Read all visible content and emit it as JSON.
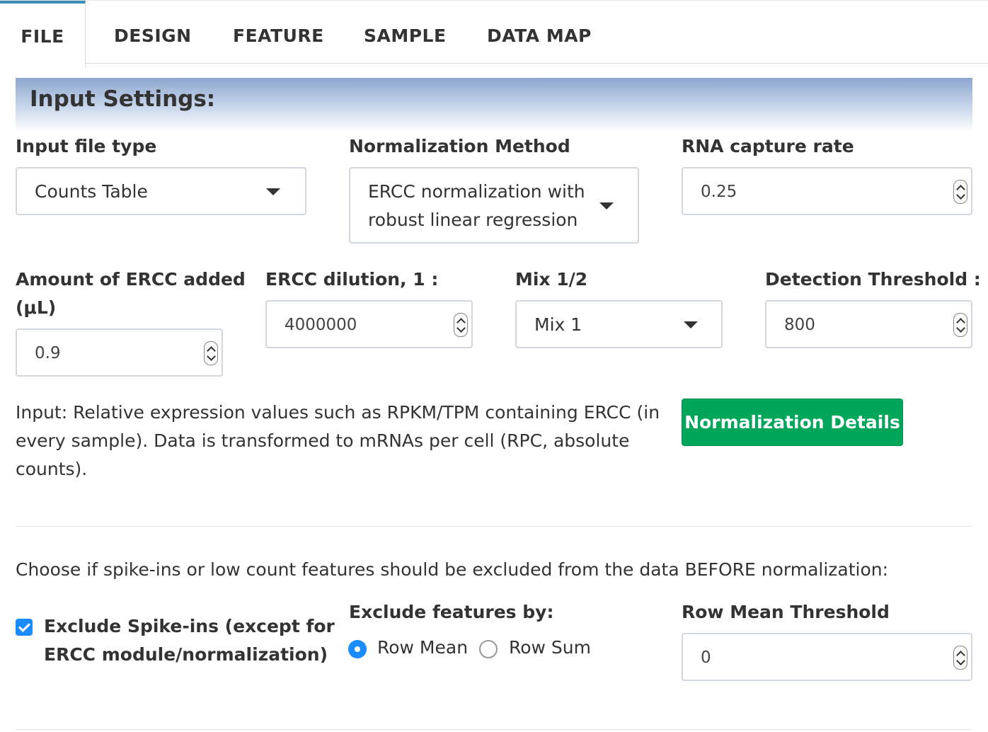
{
  "tabs": [
    {
      "label": "FILE",
      "active": true
    },
    {
      "label": "DESIGN"
    },
    {
      "label": "FEATURE"
    },
    {
      "label": "SAMPLE"
    },
    {
      "label": "DATA MAP"
    }
  ],
  "box": {
    "title": "Input Settings:"
  },
  "fields": {
    "file_type": {
      "label": "Input file type",
      "value": "Counts Table"
    },
    "norm_method": {
      "label": "Normalization Method",
      "value_line1": "ERCC normalization with",
      "value_line2": "robust linear regression"
    },
    "capture_rate": {
      "label": "RNA capture rate",
      "value": "0.25"
    },
    "ercc_amount": {
      "label_line1": "Amount of ERCC added",
      "label_line2": "(μL)",
      "value": "0.9"
    },
    "ercc_dilution": {
      "label": "ERCC dilution, 1 :",
      "value": "4000000"
    },
    "mix": {
      "label": "Mix 1/2",
      "value": "Mix 1"
    },
    "detection": {
      "label": "Detection Threshold :",
      "value": "800"
    }
  },
  "help": {
    "line1": "Input: Relative expression values such as RPKM/TPM containing ERCC (in",
    "line2": "every sample). Data is transformed to mRNAs per cell (RPC, absolute",
    "line3": "counts)."
  },
  "norm_details_button": "Normalization Details",
  "filter": {
    "instruction": "Choose if spike-ins or low count features should be excluded from the data BEFORE normalization:",
    "exclude_spikeins": {
      "label_line1": "Exclude Spike-ins (except for",
      "label_line2": "ERCC module/normalization)",
      "checked": true
    },
    "exclude_by": {
      "label": "Exclude features by:",
      "options": [
        "Row Mean",
        "Row Sum"
      ],
      "selected": "Row Mean"
    },
    "row_mean_threshold": {
      "label": "Row Mean Threshold",
      "value": "0"
    }
  },
  "colors": {
    "accent": "#3c8dbc",
    "button_green": "#00a65a",
    "control_blue": "#1a8cff"
  },
  "icons": [
    "caret-down-icon",
    "spinner-icon",
    "checkbox-checked-icon",
    "radio-selected-icon",
    "radio-unselected-icon"
  ]
}
